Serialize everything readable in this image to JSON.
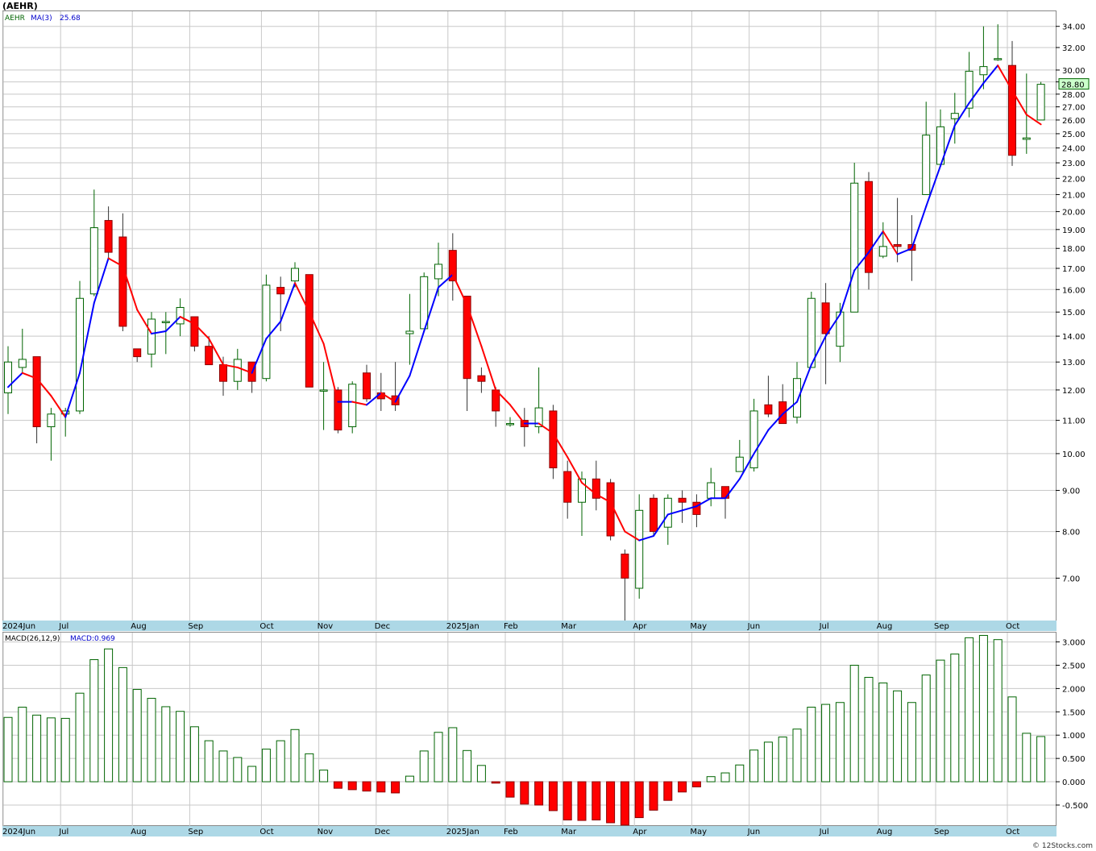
{
  "chart_title": "(AEHR)",
  "price_legend": {
    "symbol": "AEHR",
    "ma_label": "MA(3)",
    "ma_value": "25.68"
  },
  "last_price_label": "28.80",
  "macd_legend": {
    "name": "MACD(26,12,9)",
    "value_label": "MACD:0.969"
  },
  "watermark": "© 12Stocks.com",
  "colors": {
    "up_body": "#ffffff",
    "up_border": "#006400",
    "down_body": "#ff0000",
    "ma_rising": "#0000ff",
    "ma_falling": "#ff0000",
    "grid": "#c8c8c8",
    "axis_strip": "#add8e6",
    "last_price_bg": "#ccffcc"
  },
  "chart_data": [
    {
      "type": "candlestick",
      "title": "(AEHR)",
      "scale": "log",
      "ylim": [
        6.2,
        35.5
      ],
      "y_ticks": [
        7,
        8,
        9,
        10,
        11,
        12,
        13,
        14,
        15,
        16,
        17,
        18,
        19,
        20,
        21,
        22,
        23,
        24,
        25,
        26,
        27,
        28,
        29,
        30,
        32,
        34
      ],
      "y_tick_labels": [
        "7.00",
        "8.00",
        "9.00",
        "10.00",
        "11.00",
        "12.00",
        "13.00",
        "14.00",
        "15.00",
        "16.00",
        "17.00",
        "18.00",
        "19.00",
        "20.00",
        "21.00",
        "22.00",
        "23.00",
        "24.00",
        "25.00",
        "26.00",
        "27.00",
        "28.00",
        "29.00",
        "30.00",
        "32.00",
        "34.00"
      ],
      "x_month_labels": [
        {
          "label": "2024Jun",
          "week": 0
        },
        {
          "label": "Jul",
          "week": 4
        },
        {
          "label": "Aug",
          "week": 9
        },
        {
          "label": "Sep",
          "week": 13
        },
        {
          "label": "Oct",
          "week": 18
        },
        {
          "label": "Nov",
          "week": 22
        },
        {
          "label": "Dec",
          "week": 26
        },
        {
          "label": "2025Jan",
          "week": 31
        },
        {
          "label": "Feb",
          "week": 35
        },
        {
          "label": "Mar",
          "week": 39
        },
        {
          "label": "Apr",
          "week": 44
        },
        {
          "label": "May",
          "week": 48
        },
        {
          "label": "Jun",
          "week": 52
        },
        {
          "label": "Jul",
          "week": 57
        },
        {
          "label": "Aug",
          "week": 61
        },
        {
          "label": "Sep",
          "week": 65
        },
        {
          "label": "Oct",
          "week": 70
        }
      ],
      "candles": [
        [
          11.9,
          13.6,
          11.2,
          13.0
        ],
        [
          12.8,
          14.3,
          12.6,
          13.1
        ],
        [
          13.2,
          13.2,
          10.3,
          10.8
        ],
        [
          10.8,
          11.4,
          9.8,
          11.2
        ],
        [
          11.2,
          11.4,
          10.5,
          11.3
        ],
        [
          11.3,
          16.4,
          11.2,
          15.6
        ],
        [
          15.8,
          21.3,
          15.7,
          19.1
        ],
        [
          19.5,
          20.3,
          17.4,
          17.8
        ],
        [
          18.6,
          19.9,
          14.2,
          14.4
        ],
        [
          13.5,
          13.5,
          13.0,
          13.2
        ],
        [
          13.3,
          15.0,
          12.8,
          14.7
        ],
        [
          14.6,
          15.0,
          13.3,
          14.6
        ],
        [
          14.5,
          15.6,
          14.0,
          15.2
        ],
        [
          14.8,
          14.8,
          13.4,
          13.6
        ],
        [
          13.6,
          14.0,
          12.9,
          12.9
        ],
        [
          12.9,
          13.2,
          11.8,
          12.3
        ],
        [
          12.3,
          13.5,
          12.0,
          13.1
        ],
        [
          13.0,
          13.0,
          11.9,
          12.3
        ],
        [
          12.4,
          16.7,
          12.3,
          16.2
        ],
        [
          16.1,
          16.6,
          14.2,
          15.8
        ],
        [
          16.4,
          17.3,
          16.1,
          17.0
        ],
        [
          16.7,
          16.7,
          12.1,
          12.1
        ],
        [
          12.0,
          13.0,
          10.7,
          12.0
        ],
        [
          12.0,
          12.1,
          10.6,
          10.7
        ],
        [
          10.8,
          12.3,
          10.6,
          12.2
        ],
        [
          12.6,
          12.9,
          11.6,
          11.7
        ],
        [
          11.9,
          12.6,
          11.3,
          11.7
        ],
        [
          11.8,
          13.0,
          11.3,
          11.5
        ],
        [
          14.1,
          15.8,
          12.9,
          14.2
        ],
        [
          14.3,
          16.8,
          14.3,
          16.6
        ],
        [
          16.5,
          18.3,
          15.7,
          17.2
        ],
        [
          17.9,
          18.8,
          15.5,
          16.4
        ],
        [
          15.7,
          15.7,
          11.3,
          12.4
        ],
        [
          12.5,
          12.8,
          11.9,
          12.3
        ],
        [
          12.0,
          12.1,
          10.8,
          11.3
        ],
        [
          10.9,
          11.1,
          10.8,
          10.9
        ],
        [
          11.0,
          11.4,
          10.2,
          10.8
        ],
        [
          10.8,
          12.8,
          10.6,
          11.4
        ],
        [
          11.3,
          11.5,
          9.3,
          9.6
        ],
        [
          9.5,
          9.8,
          8.3,
          8.7
        ],
        [
          8.7,
          9.5,
          7.9,
          9.3
        ],
        [
          9.3,
          9.8,
          8.5,
          8.8
        ],
        [
          9.2,
          9.3,
          7.8,
          7.9
        ],
        [
          7.5,
          7.6,
          6.2,
          7.0
        ],
        [
          6.8,
          8.9,
          6.6,
          8.5
        ],
        [
          8.8,
          8.9,
          7.9,
          8.0
        ],
        [
          8.1,
          8.9,
          7.7,
          8.8
        ],
        [
          8.8,
          9.0,
          8.2,
          8.7
        ],
        [
          8.7,
          8.9,
          8.1,
          8.4
        ],
        [
          8.8,
          9.6,
          8.6,
          9.2
        ],
        [
          9.1,
          9.1,
          8.3,
          8.8
        ],
        [
          9.5,
          10.4,
          9.5,
          9.9
        ],
        [
          9.6,
          11.7,
          9.5,
          11.3
        ],
        [
          11.5,
          12.5,
          11.1,
          11.2
        ],
        [
          11.6,
          12.2,
          10.9,
          10.9
        ],
        [
          11.1,
          13.0,
          10.9,
          12.4
        ],
        [
          12.8,
          15.9,
          12.8,
          15.6
        ],
        [
          15.4,
          16.3,
          12.2,
          14.1
        ],
        [
          13.6,
          15.4,
          13.0,
          15.0
        ],
        [
          15.0,
          23.0,
          15.0,
          21.7
        ],
        [
          21.8,
          22.4,
          16.0,
          16.8
        ],
        [
          17.6,
          19.4,
          17.5,
          18.1
        ],
        [
          18.2,
          20.8,
          17.3,
          18.1
        ],
        [
          18.2,
          19.8,
          16.4,
          17.9
        ],
        [
          21.0,
          27.4,
          21.0,
          24.9
        ],
        [
          22.9,
          26.8,
          22.8,
          25.5
        ],
        [
          26.1,
          28.1,
          24.3,
          26.5
        ],
        [
          26.9,
          31.6,
          26.2,
          29.9
        ],
        [
          29.6,
          34.0,
          28.4,
          30.3
        ],
        [
          31.0,
          34.2,
          30.8,
          31.0
        ],
        [
          30.4,
          32.6,
          22.8,
          23.5
        ],
        [
          24.6,
          29.7,
          23.6,
          24.7
        ],
        [
          26.0,
          29.0,
          26.0,
          28.8
        ]
      ],
      "ma": [
        12.1,
        12.6,
        12.4,
        11.8,
        11.1,
        12.6,
        15.4,
        17.5,
        17.1,
        15.1,
        14.1,
        14.2,
        14.8,
        14.5,
        13.9,
        12.9,
        12.8,
        12.6,
        13.9,
        14.6,
        16.3,
        15.0,
        13.7,
        11.6,
        11.6,
        11.5,
        11.9,
        11.6,
        12.5,
        14.2,
        16.1,
        16.7,
        15.3,
        13.6,
        12.0,
        11.5,
        10.9,
        10.9,
        10.6,
        9.9,
        9.2,
        8.9,
        8.7,
        8.0,
        7.8,
        7.9,
        8.4,
        8.5,
        8.6,
        8.8,
        8.8,
        9.3,
        10.0,
        10.7,
        11.2,
        11.6,
        12.9,
        14.0,
        14.9,
        16.9,
        17.8,
        18.9,
        17.7,
        18.0,
        20.3,
        22.8,
        25.6,
        27.3,
        28.9,
        30.4,
        28.3,
        26.4,
        25.68
      ],
      "last_price": 28.8
    },
    {
      "type": "bar",
      "title": "MACD(26,12,9)",
      "ylim": [
        -0.95,
        3.2
      ],
      "y_ticks": [
        -0.5,
        0,
        0.5,
        1,
        1.5,
        2,
        2.5,
        3
      ],
      "y_tick_labels": [
        "-0.500",
        "0.000",
        "0.500",
        "1.000",
        "1.500",
        "2.000",
        "2.500",
        "3.000"
      ],
      "values": [
        1.38,
        1.6,
        1.43,
        1.37,
        1.36,
        1.9,
        2.62,
        2.85,
        2.45,
        1.98,
        1.79,
        1.61,
        1.51,
        1.18,
        0.88,
        0.66,
        0.52,
        0.33,
        0.7,
        0.88,
        1.12,
        0.6,
        0.25,
        -0.14,
        -0.17,
        -0.2,
        -0.22,
        -0.24,
        0.12,
        0.66,
        1.06,
        1.16,
        0.67,
        0.35,
        -0.03,
        -0.33,
        -0.48,
        -0.5,
        -0.62,
        -0.82,
        -0.83,
        -0.82,
        -0.88,
        -0.93,
        -0.77,
        -0.61,
        -0.4,
        -0.22,
        -0.11,
        0.11,
        0.19,
        0.36,
        0.68,
        0.85,
        0.96,
        1.13,
        1.6,
        1.66,
        1.7,
        2.5,
        2.24,
        2.12,
        1.95,
        1.7,
        2.29,
        2.61,
        2.74,
        3.09,
        3.14,
        3.05,
        1.82,
        1.04,
        0.97
      ],
      "latest": 0.969
    }
  ]
}
